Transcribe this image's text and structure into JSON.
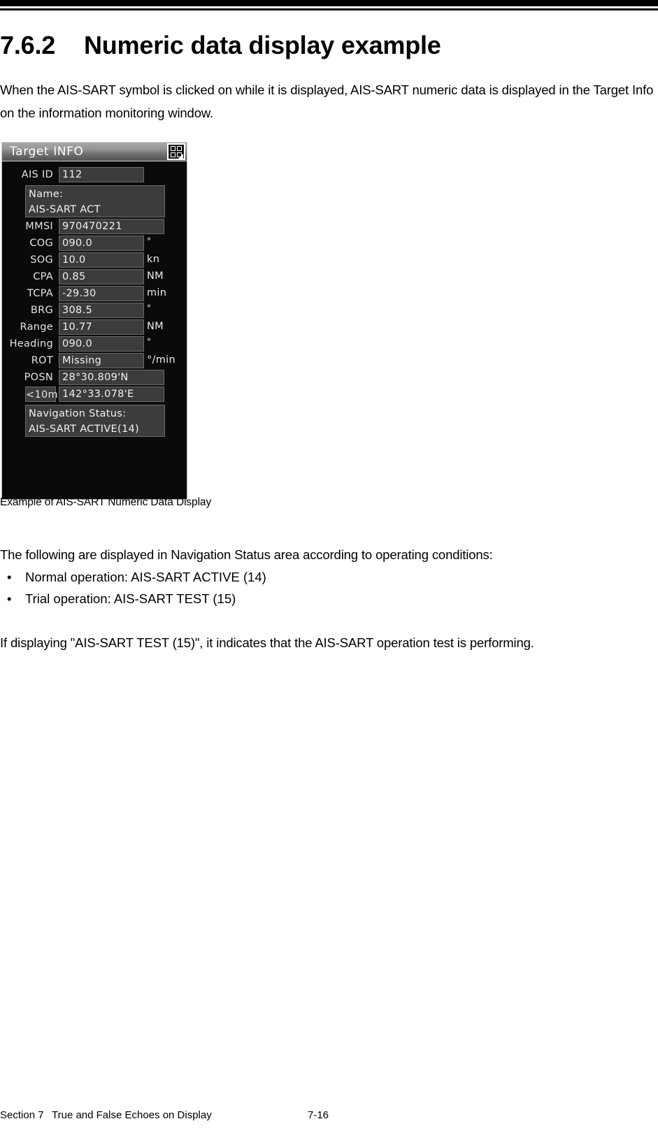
{
  "document": {
    "heading_number": "7.6.2",
    "heading_title": "Numeric data display example",
    "intro_paragraph": "When the AIS-SART symbol is clicked on while it is displayed, AIS-SART numeric data is displayed in the Target Info on the information monitoring window.",
    "figure_caption": "Example of AIS-SART Numeric Data Display",
    "following_paragraph": "The following are displayed in Navigation Status area according to operating conditions:",
    "bullets": [
      {
        "marker": "•",
        "text": "Normal operation: AIS-SART ACTIVE (14)"
      },
      {
        "marker": "•",
        "text": "Trial operation: AIS-SART TEST (15)"
      }
    ],
    "final_paragraph": "If displaying \"AIS-SART TEST (15)\", it indicates that the AIS-SART operation test is performing.",
    "footer": {
      "section": "Section 7",
      "section_title": "True and False Echoes on Display",
      "page_number": "7-16"
    }
  },
  "target_info_panel": {
    "title": "Target INFO",
    "menu_icon": "grid-2x2-icon",
    "colors": {
      "panel_background": "#0a0a0a",
      "field_background": "#3c3c3c",
      "field_border": "#6a6a6a",
      "titlebar_top": "#a8a8a8",
      "titlebar_bottom": "#525252",
      "text": "#f2f2f2"
    },
    "fields": [
      {
        "label": "AIS ID",
        "value": "112",
        "unit": ""
      },
      {
        "label": "MMSI",
        "value": "970470221",
        "unit": ""
      },
      {
        "label": "COG",
        "value": "090.0",
        "unit": "°"
      },
      {
        "label": "SOG",
        "value": "10.0",
        "unit": "kn"
      },
      {
        "label": "CPA",
        "value": "0.85",
        "unit": "NM"
      },
      {
        "label": "TCPA",
        "value": "-29.30",
        "unit": "min"
      },
      {
        "label": "BRG",
        "value": "308.5",
        "unit": "°"
      },
      {
        "label": "Range",
        "value": "10.77",
        "unit": "NM"
      },
      {
        "label": "Heading",
        "value": "090.0",
        "unit": "°"
      },
      {
        "label": "ROT",
        "value": "Missing",
        "unit": "°/min"
      },
      {
        "label": "POSN",
        "value": "28°30.809'N",
        "unit": ""
      },
      {
        "label": "<10m",
        "value": "142°33.078'E",
        "unit": ""
      }
    ],
    "name_box": {
      "line1": "Name:",
      "line2": "AIS-SART ACT"
    },
    "navigation_status_box": {
      "line1": "Navigation Status:",
      "line2": "AIS-SART ACTIVE(14)"
    }
  }
}
